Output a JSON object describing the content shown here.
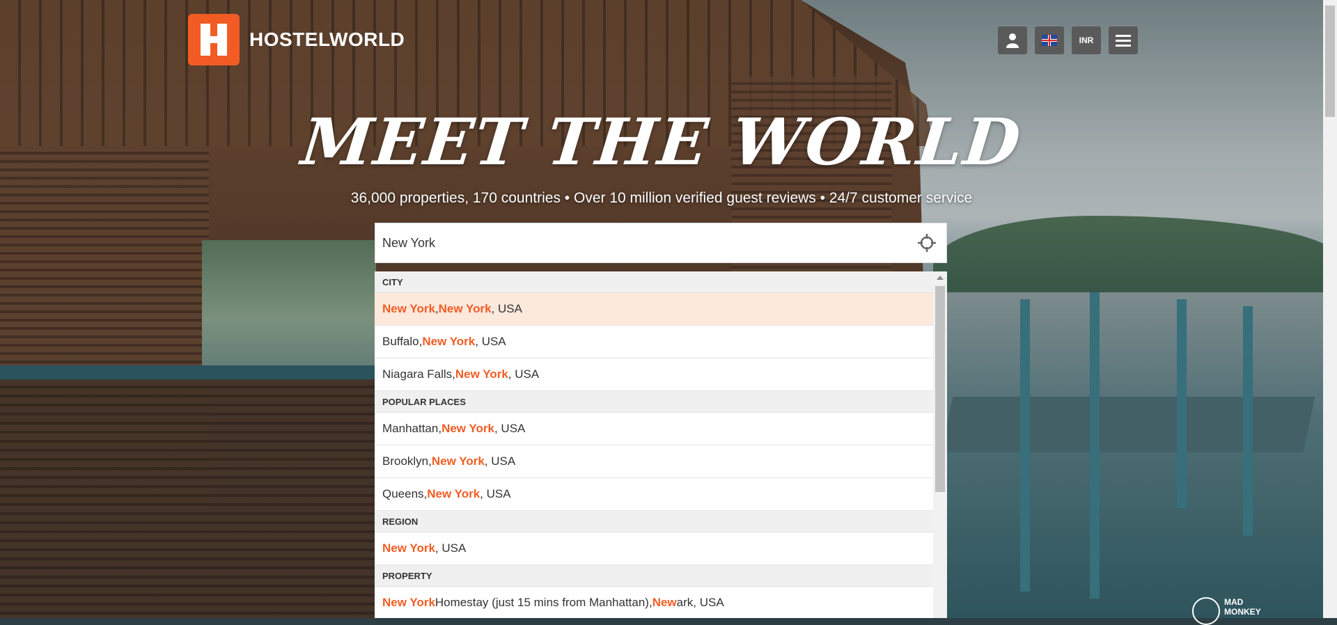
{
  "brand": {
    "name": "HOSTELWORLD",
    "accent": "#f25c24"
  },
  "header": {
    "account_icon": "user-icon",
    "language_icon": "uk-flag-icon",
    "currency": "INR",
    "menu_icon": "hamburger-icon"
  },
  "hero": {
    "title": "MEET THE WORLD",
    "subtitle": "36,000 properties, 170 countries • Over 10 million verified guest reviews • 24/7 customer service"
  },
  "search": {
    "value": "New York",
    "locate_icon": "crosshair-locate-icon"
  },
  "dropdown": {
    "groups": [
      {
        "title": "CITY",
        "items": [
          {
            "parts": [
              "New York",
              ", ",
              "New York",
              ", USA"
            ],
            "hl": [
              true,
              false,
              true,
              false
            ],
            "active": true
          },
          {
            "parts": [
              "Buffalo, ",
              "New York",
              ", USA"
            ],
            "hl": [
              false,
              true,
              false
            ]
          },
          {
            "parts": [
              "Niagara Falls, ",
              "New York",
              ", USA"
            ],
            "hl": [
              false,
              true,
              false
            ]
          }
        ]
      },
      {
        "title": "POPULAR PLACES",
        "items": [
          {
            "parts": [
              "Manhattan, ",
              "New York",
              ", USA"
            ],
            "hl": [
              false,
              true,
              false
            ]
          },
          {
            "parts": [
              "Brooklyn, ",
              "New York",
              ", USA"
            ],
            "hl": [
              false,
              true,
              false
            ]
          },
          {
            "parts": [
              "Queens, ",
              "New York",
              ", USA"
            ],
            "hl": [
              false,
              true,
              false
            ]
          }
        ]
      },
      {
        "title": "REGION",
        "items": [
          {
            "parts": [
              "New York",
              ", USA"
            ],
            "hl": [
              true,
              false
            ]
          }
        ]
      },
      {
        "title": "PROPERTY",
        "items": [
          {
            "parts": [
              "New York",
              " Homestay (just 15 mins from Manhattan), ",
              "New",
              "ark, USA"
            ],
            "hl": [
              true,
              false,
              true,
              false
            ]
          }
        ]
      }
    ]
  },
  "watermark": {
    "line1": "MAD",
    "line2": "MONKEY"
  }
}
